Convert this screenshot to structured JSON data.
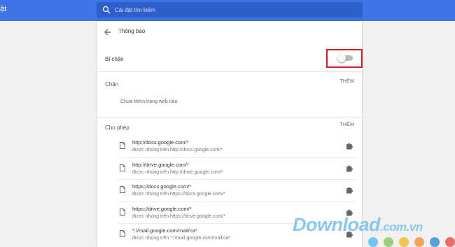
{
  "topbar": {
    "title_fragment": "ặt",
    "search_placeholder": "Cài đặt tìm kiếm"
  },
  "page": {
    "title": "Thông báo"
  },
  "blocked_toggle": {
    "label": "Bị chặn",
    "on": false
  },
  "block_section": {
    "title": "Chặn",
    "add_label": "THÊM",
    "empty_text": "Chưa thêm trang web nào"
  },
  "allow_section": {
    "title": "Cho phép",
    "add_label": "THÊM",
    "sites": [
      {
        "url": "http://docs.google.com/*",
        "embedded": "được nhúng trên http://docs.google.com/*"
      },
      {
        "url": "http://drive.google.com/*",
        "embedded": "được nhúng trên http://drive.google.com/*"
      },
      {
        "url": "https://docs.google.com/*",
        "embedded": "được nhúng trên https://docs.google.com/*"
      },
      {
        "url": "https://drive.google.com/*",
        "embedded": "được nhúng trên https://drive.google.com/*"
      },
      {
        "url": "*://mail.google.com/mail/ca*",
        "embedded": "được nhúng trên *://mail.google.com/mail/ca*"
      }
    ]
  },
  "watermark": {
    "brand": "Download",
    "domain": ".com.vn"
  },
  "colors": {
    "topbar": "#3f74e4",
    "search": "#2c5fc9",
    "highlight": "#d21f1f",
    "dots": [
      "#6fc7ef",
      "#9ad07a",
      "#f4c24d",
      "#f2a35c",
      "#5a9fdc",
      "#ec6b6b"
    ]
  },
  "icons": {
    "search": "search-icon",
    "back": "arrow-left-icon",
    "file": "file-icon",
    "extension": "puzzle-icon"
  }
}
